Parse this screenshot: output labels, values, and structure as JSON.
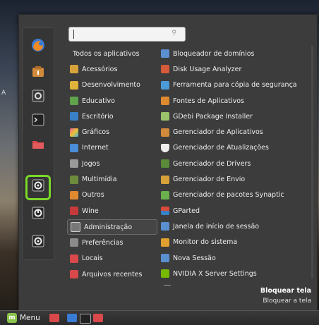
{
  "desktop": {
    "label": "A"
  },
  "search": {
    "placeholder": "",
    "icon": "search-icon"
  },
  "favorites": [
    {
      "icon": "firefox-icon",
      "color": "#3a7bd5"
    },
    {
      "icon": "software-manager-icon",
      "color": "#d18a3b"
    },
    {
      "icon": "system-settings-icon",
      "color": "#888888"
    },
    {
      "icon": "terminal-icon",
      "color": "#222222"
    },
    {
      "icon": "files-folder-icon",
      "color": "#d9484a"
    },
    {
      "icon": "lock-screen-icon",
      "color": "#dddddd"
    },
    {
      "icon": "logout-icon",
      "color": "#dddddd"
    },
    {
      "icon": "shutdown-icon",
      "color": "#dddddd"
    }
  ],
  "categories": [
    {
      "label": "Todos os aplicativos",
      "color": ""
    },
    {
      "label": "Acessórios",
      "color": "#d8a23b"
    },
    {
      "label": "Desenvolvimento",
      "color": "#e0b43a"
    },
    {
      "label": "Educativo",
      "color": "#5fa34b"
    },
    {
      "label": "Escritório",
      "color": "#3a80c8"
    },
    {
      "label": "Gráficos",
      "color": "#e05a9c"
    },
    {
      "label": "Internet",
      "color": "#4a8ed8"
    },
    {
      "label": "Jogos",
      "color": "#9a9a9a"
    },
    {
      "label": "Multimídia",
      "color": "#6c8c3c"
    },
    {
      "label": "Outros",
      "color": "#e08a30"
    },
    {
      "label": "Wine",
      "color": "#c83a3a"
    },
    {
      "label": "Administração",
      "color": "#777777"
    },
    {
      "label": "Preferências",
      "color": "#8a8a8a"
    },
    {
      "label": "Locais",
      "color": "#d9484a"
    },
    {
      "label": "Arquivos recentes",
      "color": "#d9484a"
    }
  ],
  "apps": [
    {
      "label": "Bloqueador de domínios",
      "color": "#5a8fd0"
    },
    {
      "label": "Disk Usage Analyzer",
      "color": "#d45a3a"
    },
    {
      "label": "Ferramenta para cópia de segurança",
      "color": "#4a9ad8"
    },
    {
      "label": "Fontes de Aplicativos",
      "color": "#e08a30"
    },
    {
      "label": "GDebi Package Installer",
      "color": "#9ac26a"
    },
    {
      "label": "Gerenciador de Aplicativos",
      "color": "#d18a3b"
    },
    {
      "label": "Gerenciador de Atualizações",
      "color": "#eeeeee"
    },
    {
      "label": "Gerenciador de Drivers",
      "color": "#5a8a3a"
    },
    {
      "label": "Gerenciador de Envio",
      "color": "#d8a23b"
    },
    {
      "label": "Gerenciador de pacotes Synaptic",
      "color": "#6ab04c"
    },
    {
      "label": "GParted",
      "color": "#d84a3a"
    },
    {
      "label": "Janela de início de sessão",
      "color": "#5a8fd0"
    },
    {
      "label": "Monitor do sistema",
      "color": "#e0a030"
    },
    {
      "label": "Nova Sessão",
      "color": "#5a8fd0"
    },
    {
      "label": "NVIDIA X Server Settings",
      "color": "#76b900"
    }
  ],
  "lock": {
    "title": "Bloquear tela",
    "description": "Bloquear a tela"
  },
  "taskbar": {
    "menu_label": "Menu"
  }
}
